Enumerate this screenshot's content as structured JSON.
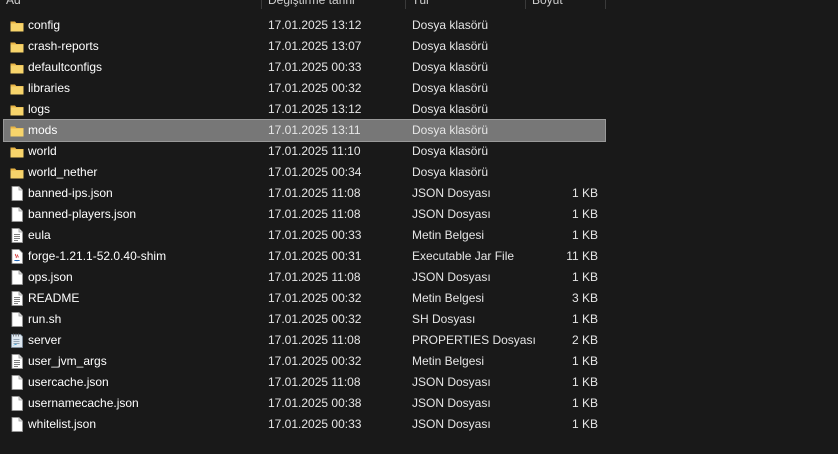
{
  "header": {
    "columns": [
      "Ad",
      "Değiştirme tarihi",
      "Tür",
      "Boyut"
    ]
  },
  "files": [
    {
      "name": "config",
      "date": "17.01.2025 13:12",
      "type": "Dosya klasörü",
      "size": "",
      "icon": "folder-icon"
    },
    {
      "name": "crash-reports",
      "date": "17.01.2025 13:07",
      "type": "Dosya klasörü",
      "size": "",
      "icon": "folder-icon"
    },
    {
      "name": "defaultconfigs",
      "date": "17.01.2025 00:33",
      "type": "Dosya klasörü",
      "size": "",
      "icon": "folder-icon"
    },
    {
      "name": "libraries",
      "date": "17.01.2025 00:32",
      "type": "Dosya klasörü",
      "size": "",
      "icon": "folder-icon"
    },
    {
      "name": "logs",
      "date": "17.01.2025 13:12",
      "type": "Dosya klasörü",
      "size": "",
      "icon": "folder-icon"
    },
    {
      "name": "mods",
      "date": "17.01.2025 13:11",
      "type": "Dosya klasörü",
      "size": "",
      "icon": "folder-icon",
      "selected": true
    },
    {
      "name": "world",
      "date": "17.01.2025 11:10",
      "type": "Dosya klasörü",
      "size": "",
      "icon": "folder-icon"
    },
    {
      "name": "world_nether",
      "date": "17.01.2025 00:34",
      "type": "Dosya klasörü",
      "size": "",
      "icon": "folder-icon"
    },
    {
      "name": "banned-ips.json",
      "date": "17.01.2025 11:08",
      "type": "JSON Dosyası",
      "size": "1 KB",
      "icon": "file-icon"
    },
    {
      "name": "banned-players.json",
      "date": "17.01.2025 11:08",
      "type": "JSON Dosyası",
      "size": "1 KB",
      "icon": "file-icon"
    },
    {
      "name": "eula",
      "date": "17.01.2025 00:33",
      "type": "Metin Belgesi",
      "size": "1 KB",
      "icon": "text-file-icon"
    },
    {
      "name": "forge-1.21.1-52.0.40-shim",
      "date": "17.01.2025 00:31",
      "type": "Executable Jar File",
      "size": "11 KB",
      "icon": "jar-file-icon"
    },
    {
      "name": "ops.json",
      "date": "17.01.2025 11:08",
      "type": "JSON Dosyası",
      "size": "1 KB",
      "icon": "file-icon"
    },
    {
      "name": "README",
      "date": "17.01.2025 00:32",
      "type": "Metin Belgesi",
      "size": "3 KB",
      "icon": "text-file-icon"
    },
    {
      "name": "run.sh",
      "date": "17.01.2025 00:32",
      "type": "SH Dosyası",
      "size": "1 KB",
      "icon": "file-icon"
    },
    {
      "name": "server",
      "date": "17.01.2025 11:08",
      "type": "PROPERTIES Dosyası",
      "size": "2 KB",
      "icon": "properties-file-icon"
    },
    {
      "name": "user_jvm_args",
      "date": "17.01.2025 00:32",
      "type": "Metin Belgesi",
      "size": "1 KB",
      "icon": "text-file-icon"
    },
    {
      "name": "usercache.json",
      "date": "17.01.2025 11:08",
      "type": "JSON Dosyası",
      "size": "1 KB",
      "icon": "file-icon"
    },
    {
      "name": "usernamecache.json",
      "date": "17.01.2025 00:38",
      "type": "JSON Dosyası",
      "size": "1 KB",
      "icon": "file-icon"
    },
    {
      "name": "whitelist.json",
      "date": "17.01.2025 00:33",
      "type": "JSON Dosyası",
      "size": "1 KB",
      "icon": "file-icon"
    }
  ],
  "colors": {
    "background": "#191919",
    "selected_row": "#777777",
    "folder": "#f2c94c"
  }
}
